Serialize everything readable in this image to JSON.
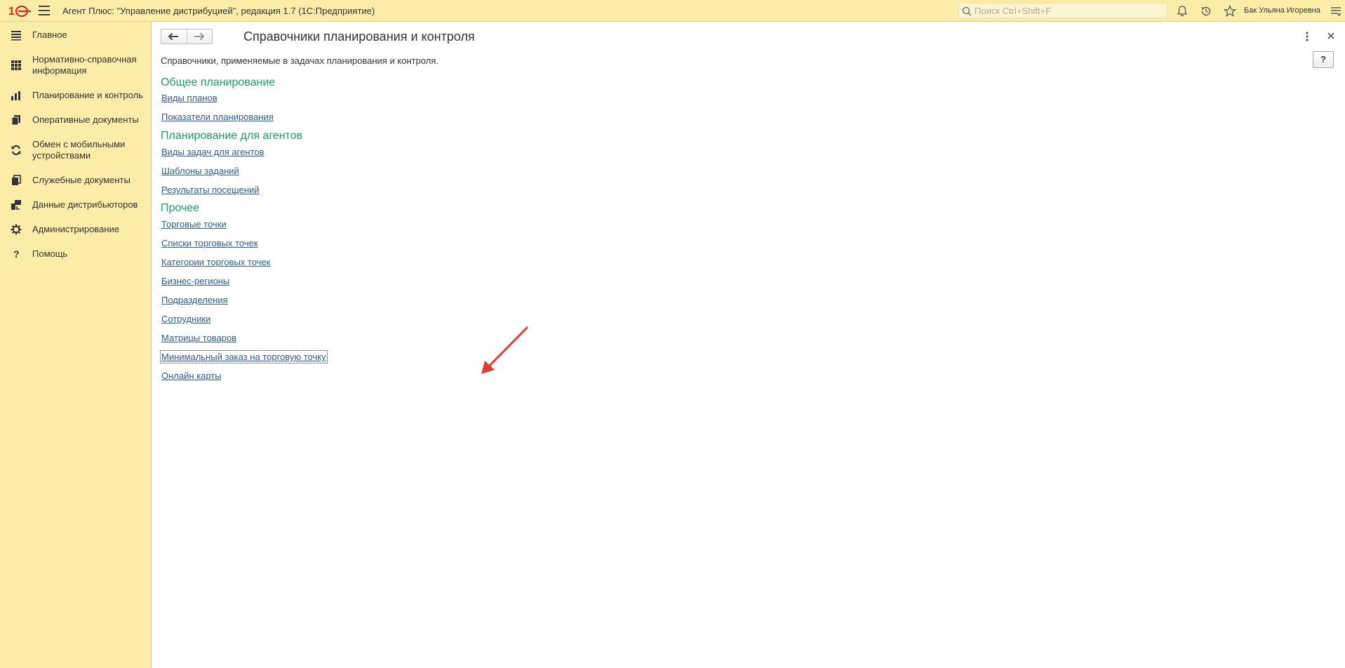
{
  "titlebar": {
    "title": "Агент Плюс: \"Управление дистрибуцией\", редакция 1.7  (1С:Предприятие)",
    "search_placeholder": "Поиск Ctrl+Shift+F",
    "user": "Бак Ульяна Игоревна"
  },
  "sidebar": {
    "items": [
      {
        "label": "Главное",
        "icon": "menu-lines-icon"
      },
      {
        "label": "Нормативно-справочная информация",
        "icon": "grid-icon"
      },
      {
        "label": "Планирование и контроль",
        "icon": "bar-chart-icon"
      },
      {
        "label": "Оперативные документы",
        "icon": "documents-icon"
      },
      {
        "label": "Обмен с мобильными устройствами",
        "icon": "sync-icon"
      },
      {
        "label": "Служебные документы",
        "icon": "service-docs-icon"
      },
      {
        "label": "Данные дистрибьюторов",
        "icon": "distributor-icon"
      },
      {
        "label": "Администрирование",
        "icon": "gear-icon"
      },
      {
        "label": "Помощь",
        "icon": "question-icon"
      }
    ]
  },
  "page": {
    "title": "Справочники планирования и контроля",
    "description": "Справочники, применяемые в задачах планирования и контроля.",
    "help_label": "?",
    "sections": [
      {
        "title": "Общее планирование",
        "links": [
          "Виды планов",
          "Показатели планирования"
        ]
      },
      {
        "title": "Планирование для агентов",
        "links": [
          "Виды задач для агентов",
          "Шаблоны заданий",
          "Результаты посещений"
        ]
      },
      {
        "title": "Прочее",
        "links": [
          "Торговые точки",
          "Списки торговых точек",
          "Категории торговых точек",
          "Бизнес-регионы",
          "Подразделения",
          "Сотрудники",
          "Матрицы товаров",
          "Минимальный заказ на торговую точку",
          "Онлайн карты"
        ]
      }
    ]
  },
  "colors": {
    "panel_bg": "#fbeda8",
    "section_title": "#19a05e",
    "link": "#2c5b94",
    "annotation_arrow": "#e53935"
  }
}
